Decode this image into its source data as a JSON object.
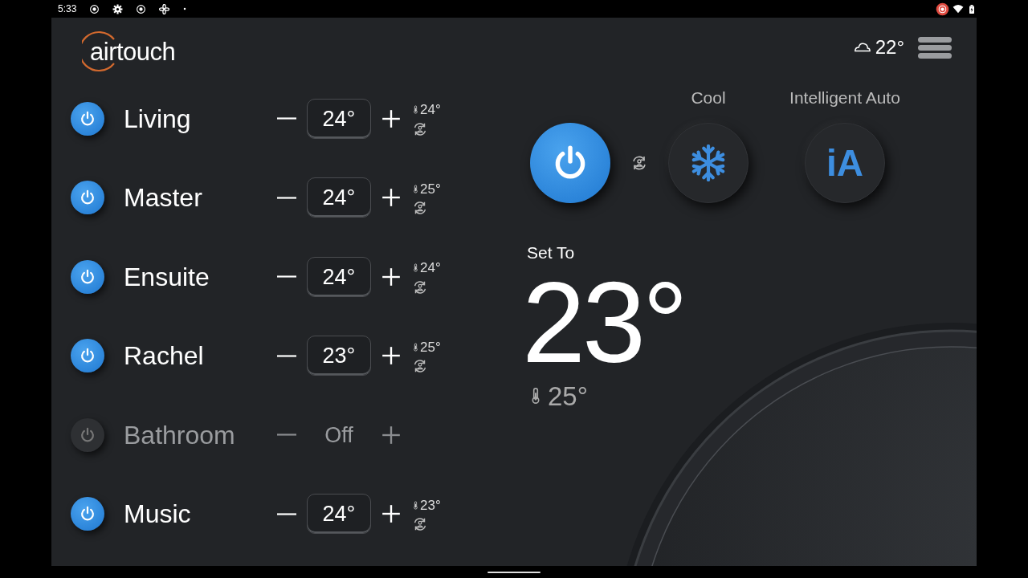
{
  "status_bar": {
    "time": "5:33"
  },
  "header": {
    "logo": "airtouch",
    "weather": {
      "temperature": "22°"
    }
  },
  "zones": [
    {
      "name": "Living",
      "on": true,
      "setpoint": "24°",
      "reading": "24°"
    },
    {
      "name": "Master",
      "on": true,
      "setpoint": "24°",
      "reading": "25°"
    },
    {
      "name": "Ensuite",
      "on": true,
      "setpoint": "24°",
      "reading": "24°"
    },
    {
      "name": "Rachel",
      "on": true,
      "setpoint": "23°",
      "reading": "25°"
    },
    {
      "name": "Bathroom",
      "on": false,
      "setpoint": "Off"
    },
    {
      "name": "Music",
      "on": true,
      "setpoint": "24°",
      "reading": "23°"
    }
  ],
  "system": {
    "on": true,
    "modes": [
      {
        "kind": "cool",
        "label": "Cool"
      },
      {
        "kind": "auto",
        "label": "Intelligent Auto",
        "icon_text": "iA"
      }
    ],
    "set_to_label": "Set To",
    "set_temperature": "23°",
    "current_temperature": "25°"
  }
}
